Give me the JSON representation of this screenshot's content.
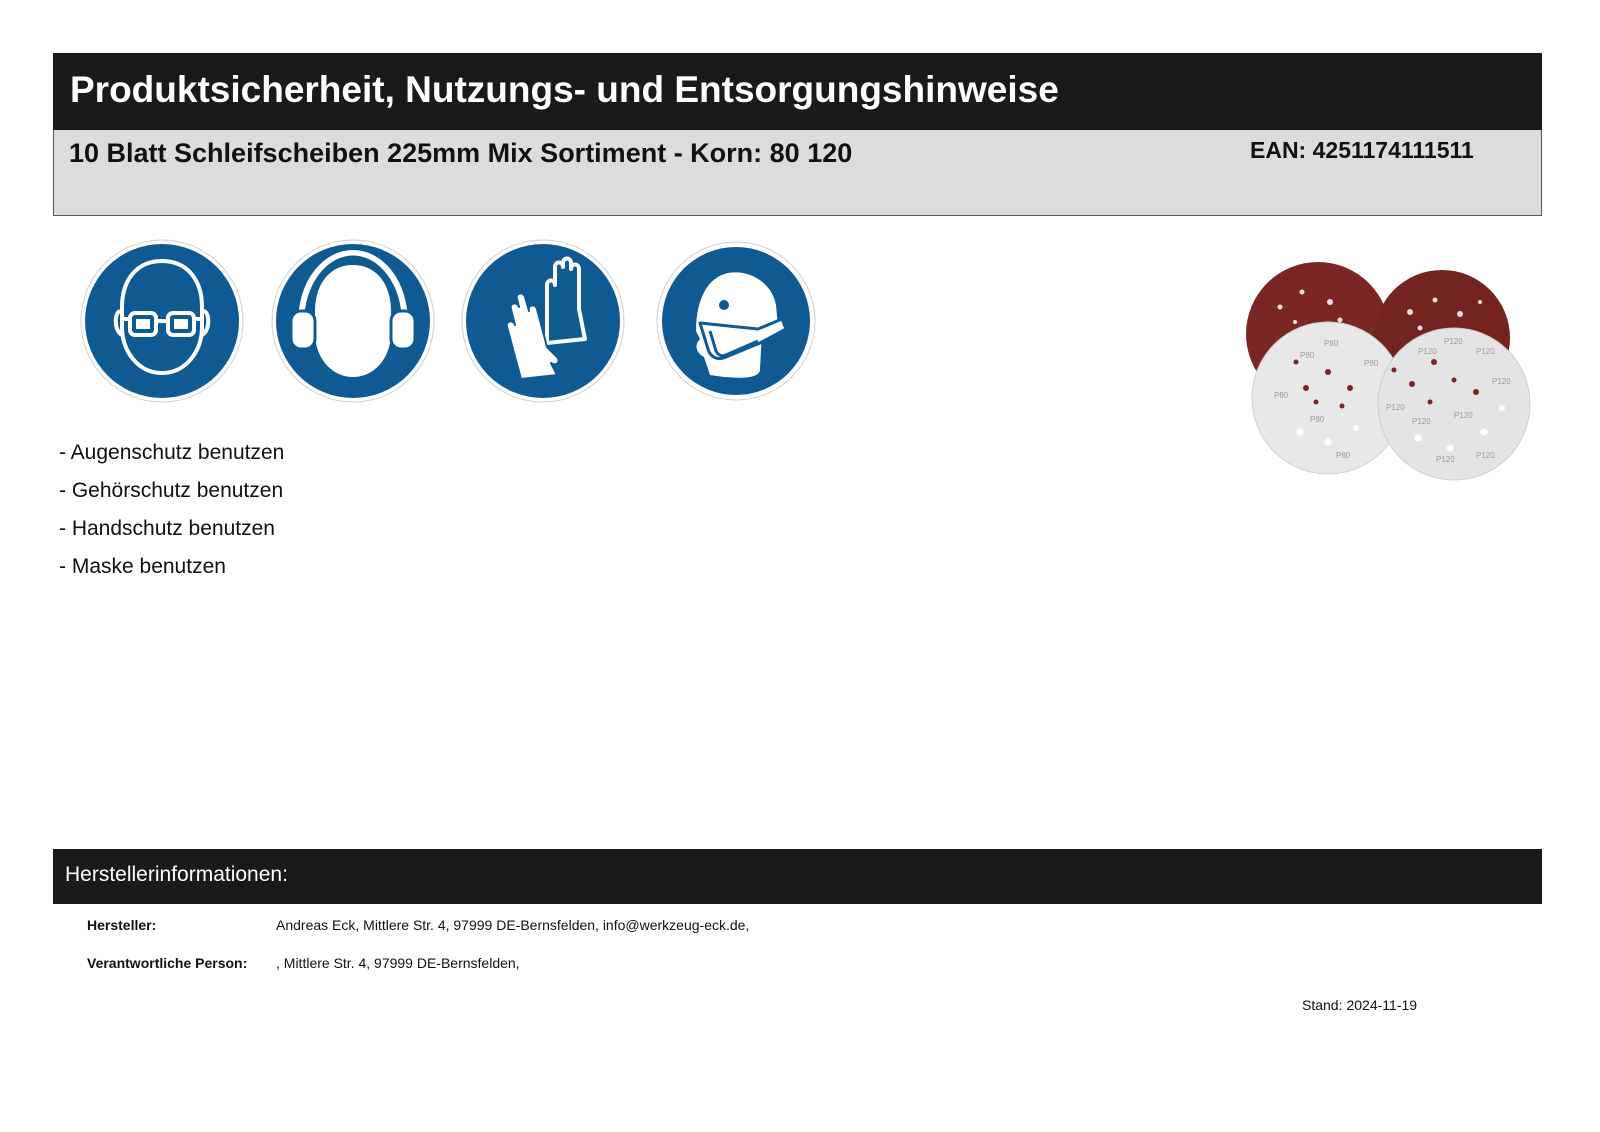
{
  "header": {
    "title": "Produktsicherheit, Nutzungs- und Entsorgungshinweise"
  },
  "product": {
    "name": "10 Blatt Schleifscheiben 225mm Mix Sortiment - Korn: 80 120",
    "ean": "EAN: 4251174111511"
  },
  "safety_signs": [
    {
      "icon": "eye-protection-icon"
    },
    {
      "icon": "hearing-protection-icon"
    },
    {
      "icon": "hand-protection-icon"
    },
    {
      "icon": "mask-icon"
    }
  ],
  "colors": {
    "sign_blue": "#0f5a93",
    "bar_dark": "#1a1a1a",
    "sub_bar_gray": "#dcdcdc",
    "disc_red": "#7a2624",
    "disc_white": "#e7e7e7"
  },
  "instructions": [
    "- Augenschutz benutzen",
    "- Gehörschutz benutzen",
    "- Handschutz benutzen",
    "- Maske benutzen"
  ],
  "manufacturer": {
    "section_title": "Herstellerinformationen:",
    "manufacturer_label": "Hersteller:",
    "manufacturer_value": "Andreas Eck, Mittlere Str. 4, 97999 DE-Bernsfelden, info@werkzeug-eck.de,",
    "responsible_label": "Verantwortliche Person:",
    "responsible_value": ", Mittlere Str. 4, 97999 DE-Bernsfelden,"
  },
  "footer": {
    "stand_label": "Stand:",
    "stand_date": "2024-11-19"
  }
}
